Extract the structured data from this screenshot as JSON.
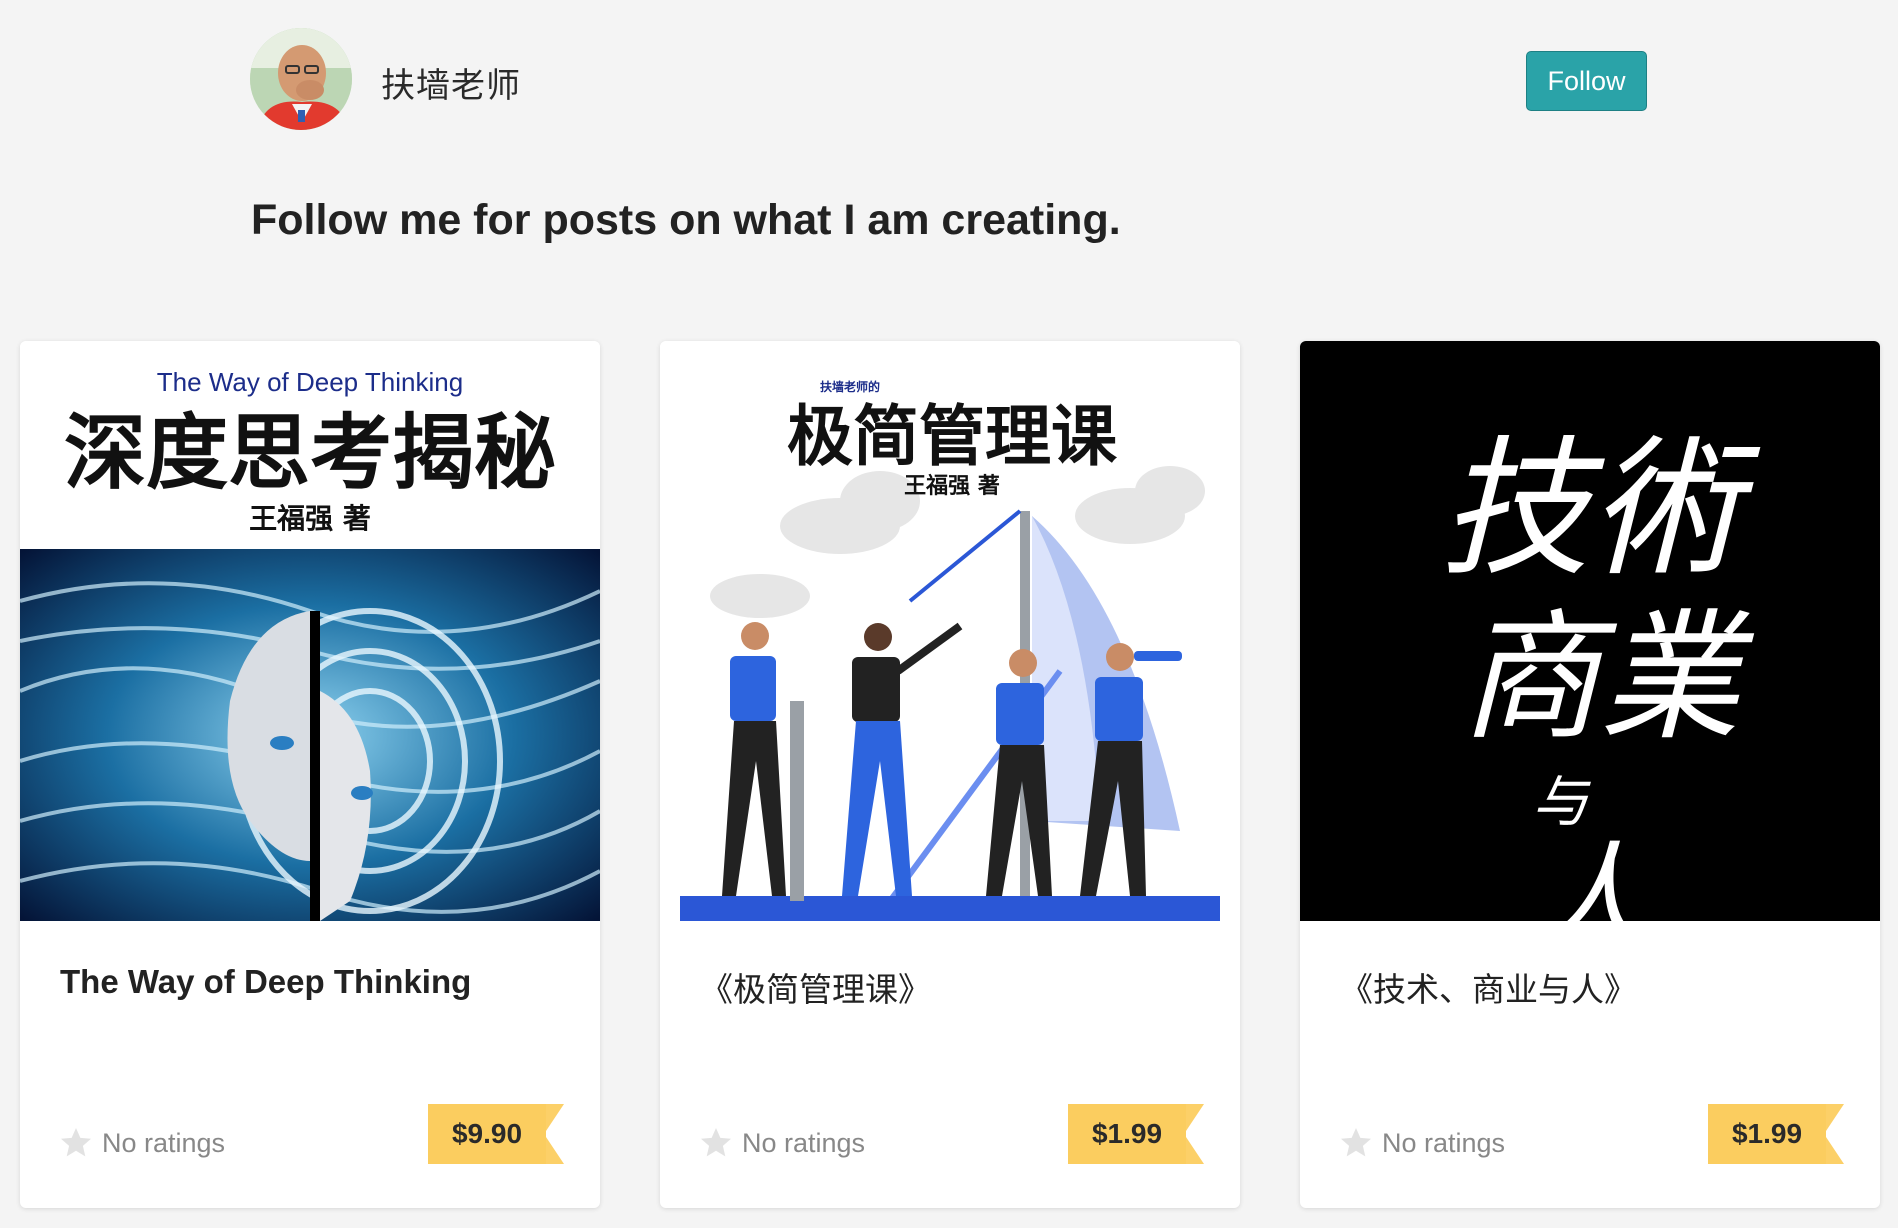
{
  "creator": {
    "name": "扶墙老师",
    "follow_label": "Follow",
    "bio": "Follow me for posts on what I am creating."
  },
  "products": [
    {
      "title": "The Way of Deep Thinking",
      "rating": "No ratings",
      "price": "$9.90",
      "cover": {
        "subtitle": "The Way of Deep Thinking",
        "heading": "深度思考揭秘",
        "author": "王福强 著"
      }
    },
    {
      "title": "《极简管理课》",
      "rating": "No ratings",
      "price": "$1.99",
      "cover": {
        "subtitle": "扶墙老师的",
        "heading": "极简管理课",
        "author": "王福强 著"
      }
    },
    {
      "title": "《技术、商业与人》",
      "rating": "No ratings",
      "price": "$1.99",
      "cover": {
        "line1": "技術",
        "line2": "商業",
        "line3": "与",
        "line4": "人"
      }
    }
  ],
  "colors": {
    "background": "#f4f4f4",
    "follow_button": "#2aa3a8",
    "price_tag": "#fcd068"
  }
}
